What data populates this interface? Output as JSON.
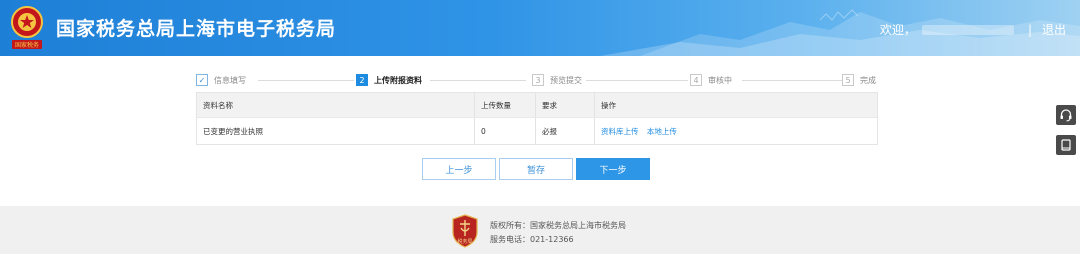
{
  "header": {
    "title": "国家税务总局上海市电子税务局",
    "emblem_caption": "国家税务",
    "welcome": "欢迎，",
    "separator": "|",
    "logout": "退出"
  },
  "steps": [
    {
      "num": "✓",
      "label": "信息填写",
      "state": "done"
    },
    {
      "num": "2",
      "label": "上传附报资料",
      "state": "active"
    },
    {
      "num": "3",
      "label": "预览提交",
      "state": "pending"
    },
    {
      "num": "4",
      "label": "审核中",
      "state": "pending"
    },
    {
      "num": "5",
      "label": "完成",
      "state": "pending"
    }
  ],
  "table": {
    "headers": [
      "资料名称",
      "上传数量",
      "要求",
      "操作"
    ],
    "rows": [
      {
        "name": "已变更的营业执照",
        "count": "0",
        "requirement": "必报",
        "actions": [
          "资料库上传",
          "本地上传"
        ]
      }
    ]
  },
  "buttons": {
    "prev": "上一步",
    "save": "暂存",
    "next": "下一步"
  },
  "side_tools": [
    "headset-icon",
    "book-icon"
  ],
  "footer": {
    "badge_text": "税务局",
    "copyright": "版权所有：国家税务总局上海市税务局",
    "phone": "服务电话：021-12366"
  },
  "colors": {
    "header_start": "#1e7fd6",
    "accent": "#1c8be0",
    "primary_button": "#2e96e6",
    "footer_bg": "#f0f0f0"
  }
}
